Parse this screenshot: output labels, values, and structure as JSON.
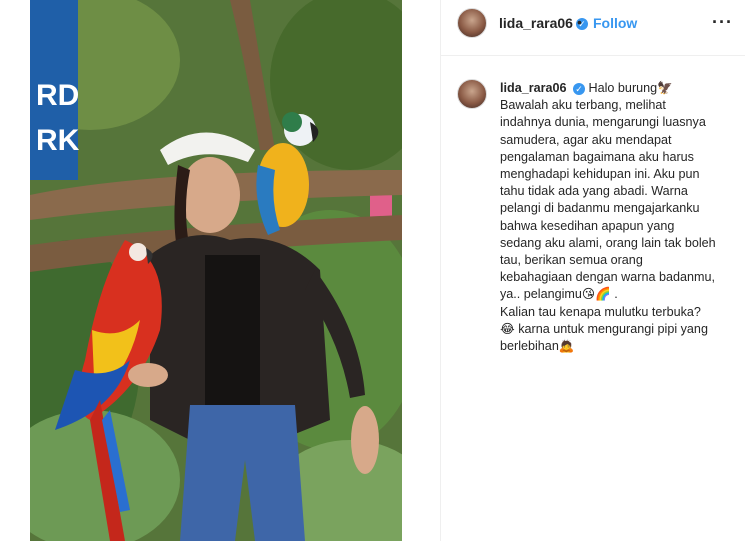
{
  "post": {
    "username": "lida_rara06",
    "follow_label": "Follow",
    "separator": "•",
    "more_label": "···",
    "verified_mark": "✓"
  },
  "caption": {
    "lines": [
      "Halo burung🦅",
      "Bawalah aku terbang, melihat",
      "indahnya dunia, mengarungi luasnya",
      "samudera, agar aku mendapat",
      "pengalaman bagaimana aku harus",
      "menghadapi kehidupan ini. Aku pun",
      "tahu tidak ada yang abadi. Warna",
      "pelangi di badanmu mengajarkanku",
      "bahwa kesedihan apapun yang",
      "sedang aku alami, orang lain tak boleh",
      "tau, berikan semua orang",
      "kebahagiaan dengan warna badanmu,",
      "ya.. pelangimu😘🌈 .",
      "Kalian tau kenapa mulutku terbuka?",
      "😂 karna untuk mengurangi pipi yang",
      "berlebihan🙇"
    ]
  },
  "colors": {
    "link_blue": "#3897f0",
    "text": "#262626",
    "border": "#efefef"
  },
  "icons": {
    "avatar": "avatar",
    "verified": "verified-badge-icon",
    "more": "more-options-icon"
  }
}
